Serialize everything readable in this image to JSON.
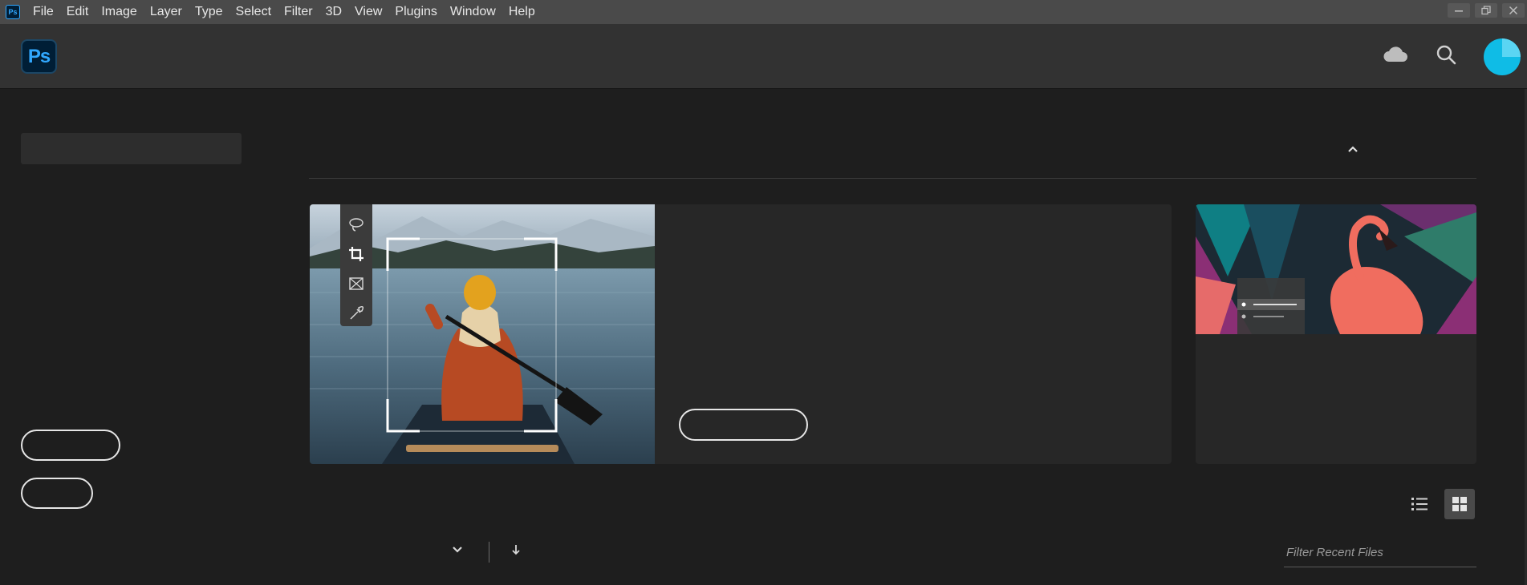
{
  "menubar": {
    "app_icon_text": "Ps",
    "items": [
      "File",
      "Edit",
      "Image",
      "Layer",
      "Type",
      "Select",
      "Filter",
      "3D",
      "View",
      "Plugins",
      "Window",
      "Help"
    ],
    "window_controls": [
      "minimize-icon",
      "restore-icon",
      "close-icon"
    ]
  },
  "header": {
    "logo_text": "Ps",
    "icons": [
      "cloud-icon",
      "search-icon",
      "avatar"
    ]
  },
  "toolbar_icons": [
    "lasso-icon",
    "crop-icon",
    "frame-icon",
    "eyedropper-icon"
  ],
  "filter": {
    "placeholder": "Filter Recent Files"
  },
  "colors": {
    "menubar": "#4a4a4a",
    "header": "#323232",
    "background": "#1e1e1e",
    "card": "#272727",
    "accent": "#31a8ff",
    "avatar": "#0fbce6"
  }
}
